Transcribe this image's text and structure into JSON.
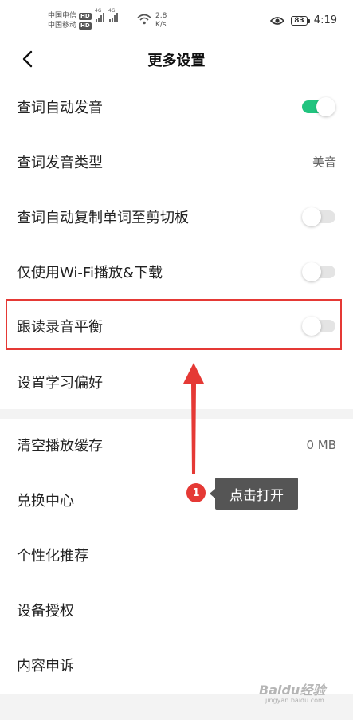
{
  "status_bar": {
    "carrier1": "中国电信",
    "carrier2": "中国移动",
    "hd": "HD",
    "lte": "4G",
    "net_speed_value": "2.8",
    "net_speed_unit": "K/s",
    "battery": "83",
    "time": "4:19"
  },
  "header": {
    "title": "更多设置"
  },
  "settings": [
    {
      "label": "查词自动发音",
      "toggle": "on"
    },
    {
      "label": "查词发音类型",
      "value": "美音"
    },
    {
      "label": "查词自动复制单词至剪切板",
      "toggle": "off"
    },
    {
      "label": "仅使用Wi-Fi播放&下载",
      "toggle": "off"
    },
    {
      "label": "跟读录音平衡",
      "toggle": "off"
    },
    {
      "label": "设置学习偏好"
    },
    {
      "label": "清空播放缓存",
      "value": "0 MB"
    },
    {
      "label": "兑换中心"
    },
    {
      "label": "个性化推荐"
    },
    {
      "label": "设备授权"
    },
    {
      "label": "内容申诉"
    }
  ],
  "annotation": {
    "step": "1",
    "callout": "点击打开"
  },
  "watermark": {
    "text": "Baidu经验",
    "sub": "jingyan.baidu.com"
  },
  "colors": {
    "accent": "#21c47f",
    "annotation_red": "#e53935"
  }
}
